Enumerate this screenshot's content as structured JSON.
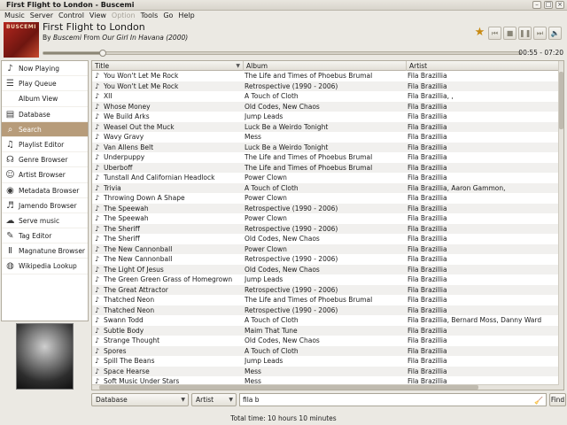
{
  "window": {
    "title": "First Flight to London - Buscemi",
    "buttons": [
      "–",
      "□",
      "×"
    ]
  },
  "menu": [
    {
      "label": "Music",
      "disabled": false
    },
    {
      "label": "Server",
      "disabled": false
    },
    {
      "label": "Control",
      "disabled": false
    },
    {
      "label": "View",
      "disabled": false
    },
    {
      "label": "Option",
      "disabled": true
    },
    {
      "label": "Tools",
      "disabled": false
    },
    {
      "label": "Go",
      "disabled": false
    },
    {
      "label": "Help",
      "disabled": false
    }
  ],
  "now_playing": {
    "cover_text": "BUSCEMI",
    "title": "First Flight to London",
    "by_label": "By",
    "artist": "Buscemi",
    "from_label": "From",
    "album": "Our Girl In Havana (2000)",
    "time": "00:55 - 07:20",
    "progress_fraction": 0.125
  },
  "sidebar": {
    "items": [
      {
        "label": "Now Playing",
        "icon": "note-icon",
        "glyph": "♪"
      },
      {
        "label": "Play Queue",
        "icon": "queue-icon",
        "glyph": "☰"
      },
      {
        "label": "Album View",
        "icon": "",
        "glyph": ""
      },
      {
        "label": "Database",
        "icon": "database-icon",
        "glyph": "▤"
      },
      {
        "label": "Search",
        "icon": "search-icon",
        "glyph": "⌕",
        "active": true
      },
      {
        "label": "Playlist Editor",
        "icon": "playlist-icon",
        "glyph": "♫"
      },
      {
        "label": "Genre Browser",
        "icon": "genre-icon",
        "glyph": "☊"
      },
      {
        "label": "Artist Browser",
        "icon": "artist-icon",
        "glyph": "☺"
      },
      {
        "label": "Metadata Browser",
        "icon": "metadata-icon",
        "glyph": "◉"
      },
      {
        "label": "Jamendo Browser",
        "icon": "jamendo-icon",
        "glyph": "♬"
      },
      {
        "label": "Serve music",
        "icon": "serve-icon",
        "glyph": "☁"
      },
      {
        "label": "Tag Editor",
        "icon": "tag-icon",
        "glyph": "✎"
      },
      {
        "label": "Magnatune Browser",
        "icon": "magnatune-icon",
        "glyph": "Ⅱ"
      },
      {
        "label": "Wikipedia Lookup",
        "icon": "wikipedia-icon",
        "glyph": "◍"
      }
    ]
  },
  "table": {
    "columns": [
      "Title",
      "Album",
      "Artist"
    ],
    "rows": [
      [
        "You Won't Let Me Rock",
        "The Life and Times of Phoebus Brumal",
        "Fila Brazillia"
      ],
      [
        "You Won't Let Me Rock",
        "Retrospective (1990 - 2006)",
        "Fila Brazillia"
      ],
      [
        "XII",
        "A Touch of Cloth",
        "Fila Brazillia, ,"
      ],
      [
        "Whose Money",
        "Old Codes, New Chaos",
        "Fila Brazillia"
      ],
      [
        "We Build Arks",
        "Jump Leads",
        "Fila Brazillia"
      ],
      [
        "Weasel Out the Muck",
        "Luck Be a Weirdo Tonight",
        "Fila Brazillia"
      ],
      [
        "Wavy Gravy",
        "Mess",
        "Fila Brazillia"
      ],
      [
        "Van Allens Belt",
        "Luck Be a Weirdo Tonight",
        "Fila Brazillia"
      ],
      [
        "Underpuppy",
        "The Life and Times of Phoebus Brumal",
        "Fila Brazillia"
      ],
      [
        "Uberboff",
        "The Life and Times of Phoebus Brumal",
        "Fila Brazillia"
      ],
      [
        "Tunstall And Californian Headlock",
        "Power Clown",
        "Fila Brazillia"
      ],
      [
        "Trivia",
        "A Touch of Cloth",
        "Fila Brazillia, Aaron Gammon,"
      ],
      [
        "Throwing Down A Shape",
        "Power Clown",
        "Fila Brazillia"
      ],
      [
        "The Speewah",
        "Retrospective (1990 - 2006)",
        "Fila Brazillia"
      ],
      [
        "The Speewah",
        "Power Clown",
        "Fila Brazillia"
      ],
      [
        "The Sheriff",
        "Retrospective (1990 - 2006)",
        "Fila Brazillia"
      ],
      [
        "The Sheriff",
        "Old Codes, New Chaos",
        "Fila Brazillia"
      ],
      [
        "The New Cannonball",
        "Power Clown",
        "Fila Brazillia"
      ],
      [
        "The New Cannonball",
        "Retrospective (1990 - 2006)",
        "Fila Brazillia"
      ],
      [
        "The Light Of Jesus",
        "Old Codes, New Chaos",
        "Fila Brazillia"
      ],
      [
        "The Green Green Grass of Homegrown",
        "Jump Leads",
        "Fila Brazillia"
      ],
      [
        "The Great Attractor",
        "Retrospective (1990 - 2006)",
        "Fila Brazillia"
      ],
      [
        "Thatched Neon",
        "The Life and Times of Phoebus Brumal",
        "Fila Brazillia"
      ],
      [
        "Thatched Neon",
        "Retrospective (1990 - 2006)",
        "Fila Brazillia"
      ],
      [
        "Swann Todd",
        "A Touch of Cloth",
        "Fila Brazillia, Bernard Moss, Danny Ward"
      ],
      [
        "Subtle Body",
        "Maim That Tune",
        "Fila Brazillia"
      ],
      [
        "Strange Thought",
        "Old Codes, New Chaos",
        "Fila Brazillia"
      ],
      [
        "Spores",
        "A Touch of Cloth",
        "Fila Brazillia"
      ],
      [
        "Spill The Beans",
        "Jump Leads",
        "Fila Brazillia"
      ],
      [
        "Space Hearse",
        "Mess",
        "Fila Brazillia"
      ],
      [
        "Soft Music Under Stars",
        "Mess",
        "Fila Brazillia"
      ]
    ]
  },
  "search": {
    "source": "Database",
    "field": "Artist",
    "query": "fila b",
    "find_label": "Find"
  },
  "status": {
    "text": "Total time: 10 hours 10 minutes"
  }
}
